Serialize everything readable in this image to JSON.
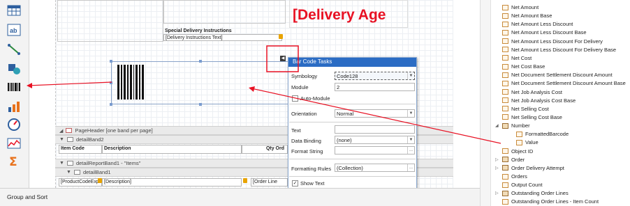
{
  "toolbox": {
    "items": [
      {
        "name": "table-tool-icon"
      },
      {
        "name": "label-tool-icon"
      },
      {
        "name": "line-tool-icon"
      },
      {
        "name": "shape-tool-icon"
      },
      {
        "name": "barcode-tool-icon"
      },
      {
        "name": "chart-tool-icon"
      },
      {
        "name": "gauge-tool-icon"
      },
      {
        "name": "sparkline-tool-icon"
      },
      {
        "name": "summary-tool-icon"
      }
    ]
  },
  "design": {
    "delivery_title": "[Delivery Age",
    "special_instructions_header": "Special Delivery Instructions",
    "special_instructions_field": "[Delivery Instructions Text]",
    "bands": {
      "page_header": "PageHeader [one band per page]",
      "detail_band2": "detailBand2",
      "detail_report_band1": "detailReportBand1 - \"Items\"",
      "detail_band1": "detailBand1"
    },
    "table_headers": {
      "item_code": "Item Code",
      "description": "Description",
      "qty_ord": "Qty Ord"
    },
    "detail_cells": {
      "product_code": "[ProductCodeExp",
      "description": "[Description]",
      "order_line": "[Order Line"
    }
  },
  "tasks": {
    "title": "Bar Code Tasks",
    "symbology_label": "Symbology",
    "symbology_value": "Code128",
    "module_label": "Module",
    "module_value": "2",
    "auto_module_label": "Auto-Module",
    "orientation_label": "Orientation",
    "orientation_value": "Normal",
    "text_label": "Text",
    "text_value": "",
    "data_binding_label": "Data Binding",
    "data_binding_value": "(none)",
    "format_string_label": "Format String",
    "format_string_value": "",
    "formatting_rules_label": "Formatting Rules",
    "formatting_rules_value": "(Collection)",
    "show_text_label": "Show Text",
    "ellipsis": "...",
    "collapse_glyph": "◀"
  },
  "fields": {
    "items": [
      {
        "label": "Net Amount",
        "indent": 1
      },
      {
        "label": "Net Amount Base",
        "indent": 1
      },
      {
        "label": "Net Amount Less Discount",
        "indent": 1
      },
      {
        "label": "Net Amount Less Discount Base",
        "indent": 1
      },
      {
        "label": "Net Amount Less Discount For Delivery",
        "indent": 1
      },
      {
        "label": "Net Amount Less Discount For Delivery Base",
        "indent": 1
      },
      {
        "label": "Net Cost",
        "indent": 1
      },
      {
        "label": "Net Cost Base",
        "indent": 1
      },
      {
        "label": "Net Document Settlement Discount Amount",
        "indent": 1
      },
      {
        "label": "Net Document Settlement Discount Amount Base",
        "indent": 1
      },
      {
        "label": "Net Job Analysis Cost",
        "indent": 1
      },
      {
        "label": "Net Job Analysis Cost Base",
        "indent": 1
      },
      {
        "label": "Net Selling Cost",
        "indent": 1
      },
      {
        "label": "Net Selling Cost Base",
        "indent": 1
      },
      {
        "label": "Number",
        "indent": 1,
        "expander": "◢"
      },
      {
        "label": "FormattedBarcode",
        "indent": 2
      },
      {
        "label": "Value",
        "indent": 2
      },
      {
        "label": "Object ID",
        "indent": 1
      },
      {
        "label": "Order",
        "indent": 1,
        "expander": "▷"
      },
      {
        "label": "Order Delivery Attempt",
        "indent": 1,
        "expander": "▷"
      },
      {
        "label": "Orders",
        "indent": 1
      },
      {
        "label": "Output Count",
        "indent": 1
      },
      {
        "label": "Outstanding Order Lines",
        "indent": 1,
        "expander": "▷"
      },
      {
        "label": "Outstanding Order Lines - Item Count",
        "indent": 1
      }
    ]
  },
  "group_sort": {
    "label": "Group and Sort"
  },
  "colors": {
    "accent_red": "#e81123",
    "selection_blue": "#2b6cc4"
  }
}
